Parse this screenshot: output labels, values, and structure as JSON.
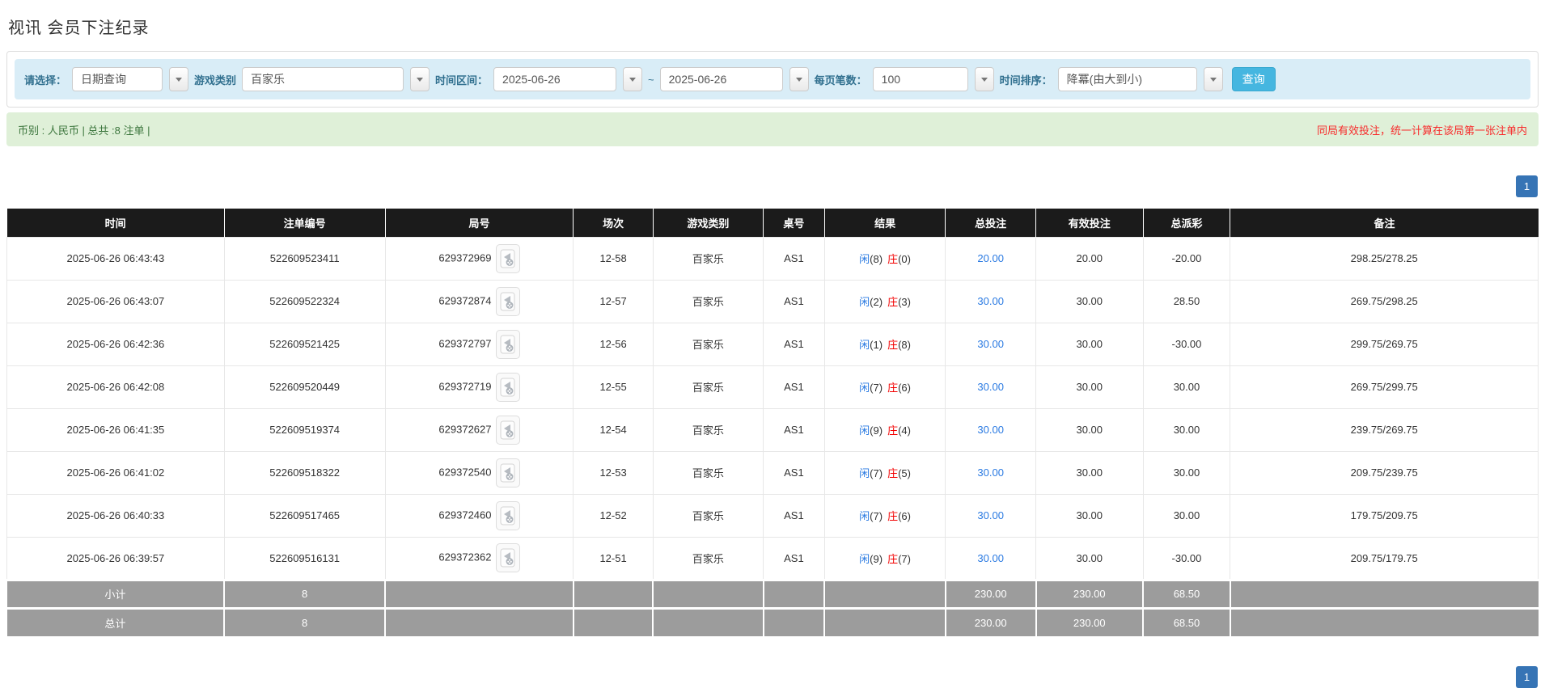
{
  "page": {
    "title": "视讯 会员下注纪录"
  },
  "filters": {
    "select_label": "请选择：",
    "select_value": "日期查询",
    "game_type_label": "游戏类别",
    "game_type_value": "百家乐",
    "time_range_label": "时间区间：",
    "date_from": "2025-06-26",
    "tilde": "~",
    "date_to": "2025-06-26",
    "page_size_label": "每页笔数：",
    "page_size_value": "100",
    "sort_label": "时间排序：",
    "sort_value": "降冪(由大到小)",
    "search_button": "查询"
  },
  "summary": {
    "left": "币别 : 人民币 | 总共 :8 注单 |",
    "right_note": "同局有效投注，统一计算在该局第一张注单内"
  },
  "pagination": {
    "current_page": "1"
  },
  "icons": {
    "combo_arrow": "chevron-down-icon",
    "video": "video-replay-icon"
  },
  "colors": {
    "filter_bar_bg": "#d9edf7",
    "filter_label": "#31708f",
    "summary_bg": "#dff0d8",
    "summary_text": "#3c763d",
    "note_red": "#f72c2c",
    "header_bg": "#1b1b1b",
    "link_blue": "#2a7ae2",
    "loss_red": "#f20000",
    "summary_row_bg": "#9c9c9c",
    "search_button_bg": "#45b6e0",
    "pagination_bg": "#3674b5"
  },
  "table": {
    "headers": [
      "时间",
      "注单编号",
      "局号",
      "场次",
      "游戏类别",
      "桌号",
      "结果",
      "总投注",
      "有效投注",
      "总派彩",
      "备注"
    ],
    "rows": [
      {
        "time": "2025-06-26 06:43:43",
        "bet_id": "522609523411",
        "round_id": "629372969",
        "session": "12-58",
        "game": "百家乐",
        "table_no": "AS1",
        "player": "闲",
        "player_n": "(8)",
        "banker": "庄",
        "banker_n": "(0)",
        "total_bet": "20.00",
        "valid_bet": "20.00",
        "payout": "-20.00",
        "note": "298.25/278.25"
      },
      {
        "time": "2025-06-26 06:43:07",
        "bet_id": "522609522324",
        "round_id": "629372874",
        "session": "12-57",
        "game": "百家乐",
        "table_no": "AS1",
        "player": "闲",
        "player_n": "(2)",
        "banker": "庄",
        "banker_n": "(3)",
        "total_bet": "30.00",
        "valid_bet": "30.00",
        "payout": "28.50",
        "note": "269.75/298.25"
      },
      {
        "time": "2025-06-26 06:42:36",
        "bet_id": "522609521425",
        "round_id": "629372797",
        "session": "12-56",
        "game": "百家乐",
        "table_no": "AS1",
        "player": "闲",
        "player_n": "(1)",
        "banker": "庄",
        "banker_n": "(8)",
        "total_bet": "30.00",
        "valid_bet": "30.00",
        "payout": "-30.00",
        "note": "299.75/269.75"
      },
      {
        "time": "2025-06-26 06:42:08",
        "bet_id": "522609520449",
        "round_id": "629372719",
        "session": "12-55",
        "game": "百家乐",
        "table_no": "AS1",
        "player": "闲",
        "player_n": "(7)",
        "banker": "庄",
        "banker_n": "(6)",
        "total_bet": "30.00",
        "valid_bet": "30.00",
        "payout": "30.00",
        "note": "269.75/299.75"
      },
      {
        "time": "2025-06-26 06:41:35",
        "bet_id": "522609519374",
        "round_id": "629372627",
        "session": "12-54",
        "game": "百家乐",
        "table_no": "AS1",
        "player": "闲",
        "player_n": "(9)",
        "banker": "庄",
        "banker_n": "(4)",
        "total_bet": "30.00",
        "valid_bet": "30.00",
        "payout": "30.00",
        "note": "239.75/269.75"
      },
      {
        "time": "2025-06-26 06:41:02",
        "bet_id": "522609518322",
        "round_id": "629372540",
        "session": "12-53",
        "game": "百家乐",
        "table_no": "AS1",
        "player": "闲",
        "player_n": "(7)",
        "banker": "庄",
        "banker_n": "(5)",
        "total_bet": "30.00",
        "valid_bet": "30.00",
        "payout": "30.00",
        "note": "209.75/239.75"
      },
      {
        "time": "2025-06-26 06:40:33",
        "bet_id": "522609517465",
        "round_id": "629372460",
        "session": "12-52",
        "game": "百家乐",
        "table_no": "AS1",
        "player": "闲",
        "player_n": "(7)",
        "banker": "庄",
        "banker_n": "(6)",
        "total_bet": "30.00",
        "valid_bet": "30.00",
        "payout": "30.00",
        "note": "179.75/209.75"
      },
      {
        "time": "2025-06-26 06:39:57",
        "bet_id": "522609516131",
        "round_id": "629372362",
        "session": "12-51",
        "game": "百家乐",
        "table_no": "AS1",
        "player": "闲",
        "player_n": "(9)",
        "banker": "庄",
        "banker_n": "(7)",
        "total_bet": "30.00",
        "valid_bet": "30.00",
        "payout": "-30.00",
        "note": "209.75/179.75"
      }
    ],
    "subtotal": {
      "label": "小计",
      "count": "8",
      "total_bet": "230.00",
      "valid_bet": "230.00",
      "payout": "68.50"
    },
    "total": {
      "label": "总计",
      "count": "8",
      "total_bet": "230.00",
      "valid_bet": "230.00",
      "payout": "68.50"
    }
  }
}
